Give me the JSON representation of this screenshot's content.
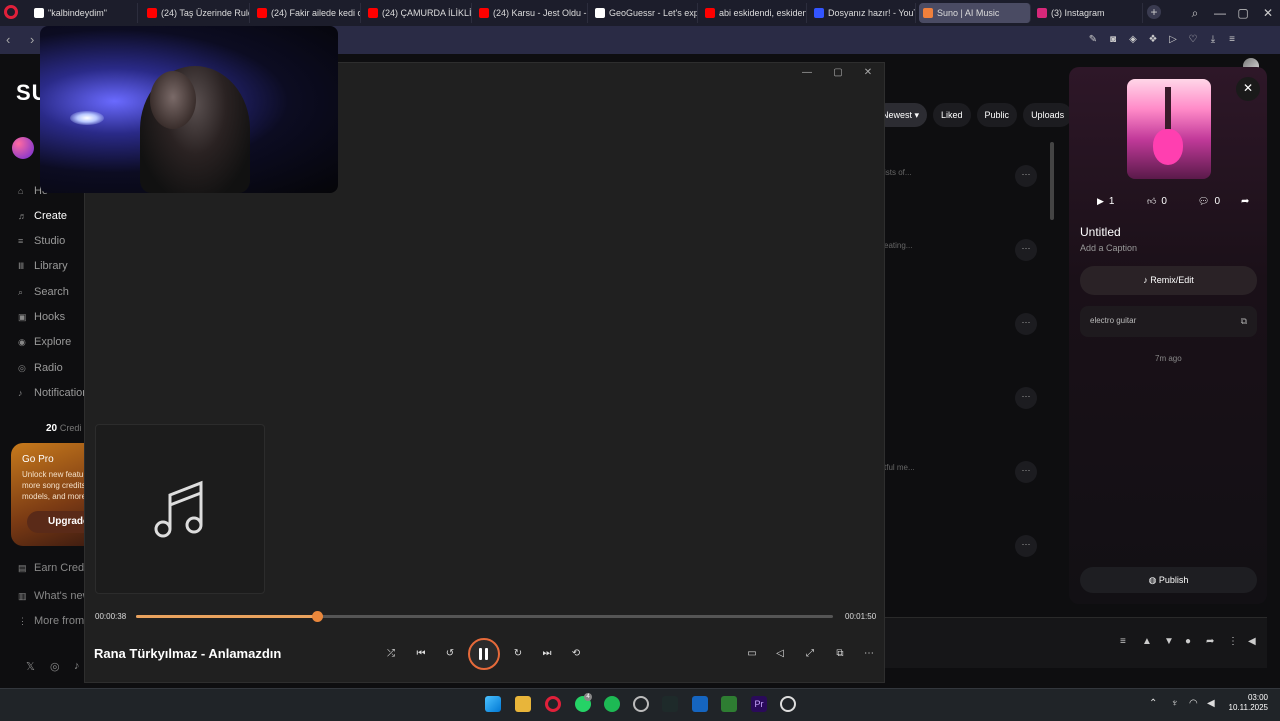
{
  "browser": {
    "tabs": [
      {
        "label": "\"kalbindeydim\"",
        "fav_color": "#ffffff"
      },
      {
        "label": "(24) Taş Üzerinde Rulo Kö",
        "fav_color": "#ff0000"
      },
      {
        "label": "(24) Fakir ailede kedi olm",
        "fav_color": "#ff0000"
      },
      {
        "label": "(24) ÇAMURDA İLİKLİ DA",
        "fav_color": "#ff0000"
      },
      {
        "label": "(24) Karsu - Jest Oldu - Y",
        "fav_color": "#ff0000"
      },
      {
        "label": "GeoGuessr - Let's explore",
        "fav_color": "#ffffff"
      },
      {
        "label": "abi eskidendi, eskiden! - Y",
        "fav_color": "#ff0000"
      },
      {
        "label": "Dosyanız hazır! - YouTub",
        "fav_color": "#3355ff"
      },
      {
        "label": "Suno | AI Music",
        "fav_color": "#f0803c",
        "active": true
      },
      {
        "label": "(3) Instagram",
        "fav_color": "#d6287a"
      }
    ],
    "new_tab": "+"
  },
  "sidebar": {
    "logo": "SU",
    "nav": [
      {
        "label": "Ho",
        "icon": "home-icon",
        "glyph": "⌂"
      },
      {
        "label": "Create",
        "icon": "music-note-icon",
        "glyph": "♬",
        "active": true
      },
      {
        "label": "Studio",
        "icon": "studio-icon",
        "glyph": "≡"
      },
      {
        "label": "Library",
        "icon": "library-icon",
        "glyph": "Ⅲ"
      },
      {
        "label": "Search",
        "icon": "search-icon",
        "glyph": "⌕"
      },
      {
        "label": "Hooks",
        "icon": "hooks-icon",
        "glyph": "▣"
      },
      {
        "label": "Explore",
        "icon": "explore-icon",
        "glyph": "◉"
      },
      {
        "label": "Radio",
        "icon": "radio-icon",
        "glyph": "◎"
      },
      {
        "label": "Notification",
        "icon": "bell-icon",
        "glyph": "♪"
      }
    ],
    "credits_num": "20",
    "credits_label": "Credi",
    "gopro": {
      "title": "Go Pro",
      "desc": "Unlock new featu more song credits models, and more!",
      "button": "Upgrade"
    },
    "footer": [
      {
        "label": "Earn Credi",
        "icon": "earn-icon",
        "glyph": "▤"
      },
      {
        "label": "What's new",
        "icon": "news-icon",
        "glyph": "▥"
      },
      {
        "label": "More from",
        "icon": "more-icon",
        "glyph": "⋮"
      }
    ],
    "social": [
      "𝕏",
      "◎",
      "♪"
    ]
  },
  "filters": [
    "Newest ▾",
    "Liked",
    "Public",
    "Uploads"
  ],
  "list_fragments": [
    "ists of...",
    "eating...",
    "tful me..."
  ],
  "row_more": "···",
  "right_panel": {
    "plays": "1",
    "likes": "0",
    "comments": "0",
    "title": "Untitled",
    "caption": "Add a Caption",
    "remix": "♪ Remix/Edit",
    "tag": "electro guitar",
    "ago": "7m ago",
    "publish": "◍ Publish",
    "close": "✕"
  },
  "media_player": {
    "elapsed": "00:00:38",
    "duration": "00:01:50",
    "progress": 0.26,
    "track_title": "Rana Türkyılmaz - Anlamazdın",
    "accent": "#e9873c"
  },
  "taskbar": {
    "time": "03:00",
    "date": "10.11.2025",
    "badge": "4"
  }
}
